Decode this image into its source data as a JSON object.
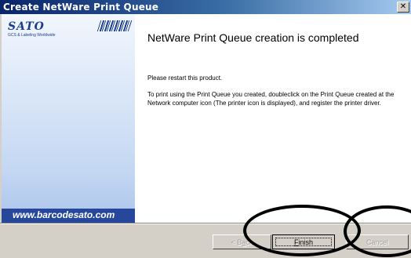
{
  "window": {
    "title": "Create NetWare Print Queue",
    "close_glyph": "✕"
  },
  "side_panel": {
    "logo": "SATO",
    "tagline": "GCS & Labeling Worldwide",
    "website": "www.barcodesato.com",
    "accent_color": "#27489a"
  },
  "content": {
    "heading": "NetWare Print Queue creation is completed",
    "paragraph_1": "Please restart this product.",
    "paragraph_2": "To print using the Print Queue you created, doubleclick on the Print Queue created at the Network computer icon (The printer icon is displayed), and register the printer driver."
  },
  "buttons": {
    "back": {
      "label_pre": "< B",
      "label_ul": "a",
      "label_post": "ck",
      "enabled": false
    },
    "finish": {
      "label_ul": "F",
      "label_post": "inish",
      "enabled": true
    },
    "cancel": {
      "label": "Cancel",
      "enabled": false
    }
  },
  "icons": {
    "close": "close-icon",
    "barcode": "barcode-icon"
  }
}
